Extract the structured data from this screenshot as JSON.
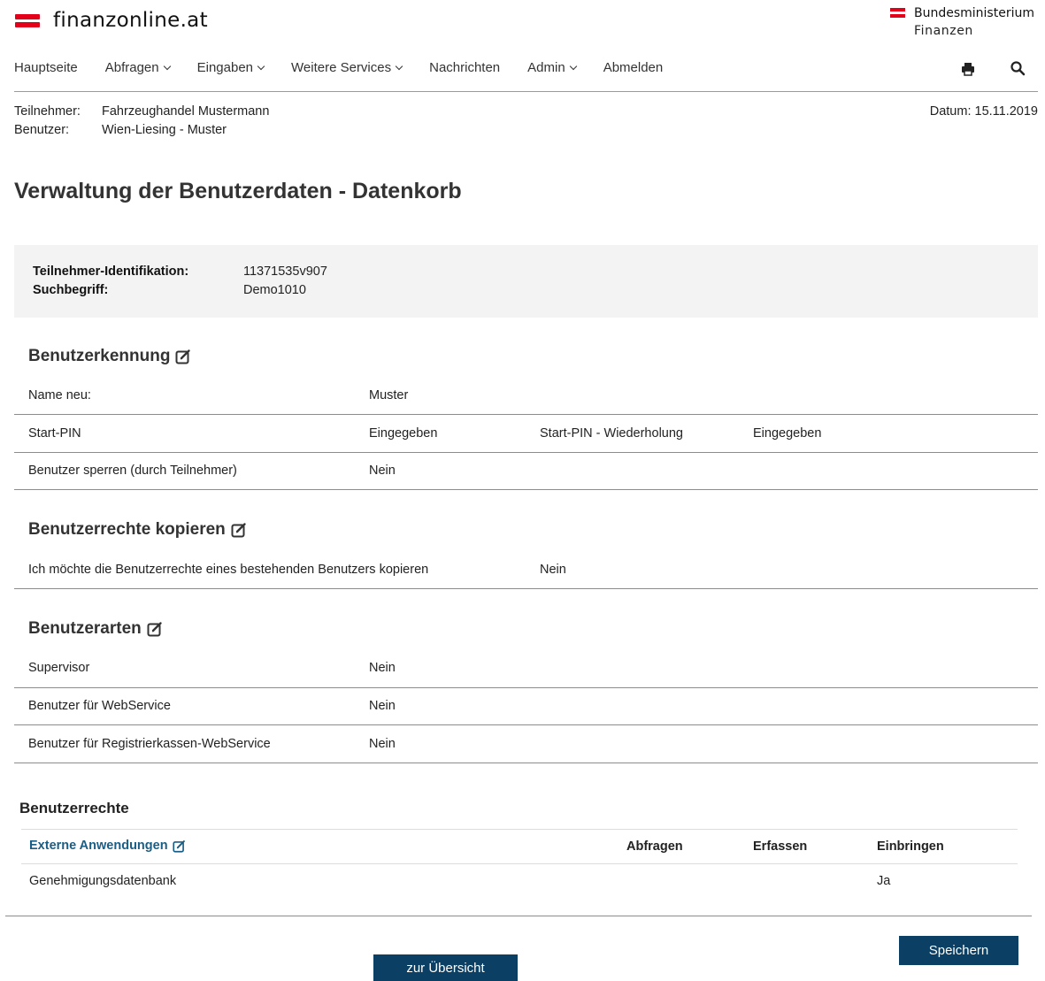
{
  "header": {
    "site_name": "finanzonline.at",
    "ministry_line1": "Bundesministerium",
    "ministry_line2": "Finanzen",
    "brand_color": "#e3001b"
  },
  "nav": {
    "items": [
      {
        "label": "Hauptseite",
        "dropdown": false
      },
      {
        "label": "Abfragen",
        "dropdown": true
      },
      {
        "label": "Eingaben",
        "dropdown": true
      },
      {
        "label": "Weitere Services",
        "dropdown": true
      },
      {
        "label": "Nachrichten",
        "dropdown": false
      },
      {
        "label": "Admin",
        "dropdown": true
      },
      {
        "label": "Abmelden",
        "dropdown": false
      }
    ],
    "icons": [
      "print-icon",
      "search-icon"
    ]
  },
  "meta": {
    "participant_label": "Teilnehmer:",
    "participant_value": "Fahrzeughandel Mustermann",
    "user_label": "Benutzer:",
    "user_value": "Wien-Liesing - Muster",
    "date": "Datum: 15.11.2019"
  },
  "page": {
    "title": "Verwaltung der Benutzerdaten - Datenkorb"
  },
  "idbox": {
    "id_label": "Teilnehmer-Identifikation:",
    "id_value": "11371535v907",
    "search_label": "Suchbegriff:",
    "search_value": "Demo1010"
  },
  "benutzerkennung": {
    "title": "Benutzerkennung",
    "name_label": "Name neu:",
    "name_value": "Muster",
    "pin_label": "Start-PIN",
    "pin_value": "Eingegeben",
    "pin_repeat_label": "Start-PIN - Wiederholung",
    "pin_repeat_value": "Eingegeben",
    "lock_label": "Benutzer sperren (durch Teilnehmer)",
    "lock_value": "Nein"
  },
  "kopieren": {
    "title": "Benutzerrechte kopieren",
    "copy_label": "Ich möchte die Benutzerrechte eines bestehenden Benutzers kopieren",
    "copy_value": "Nein"
  },
  "arten": {
    "title": "Benutzerarten",
    "rows": [
      {
        "label": "Supervisor",
        "value": "Nein"
      },
      {
        "label": "Benutzer für WebService",
        "value": "Nein"
      },
      {
        "label": "Benutzer für Registrierkassen-WebService",
        "value": "Nein"
      }
    ]
  },
  "rechte": {
    "title": "Benutzerrechte",
    "link_label": "Externe Anwendungen",
    "col_abfragen": "Abfragen",
    "col_erfassen": "Erfassen",
    "col_einbringen": "Einbringen",
    "row_name": "Genehmigungsdatenbank",
    "row_abfragen": "",
    "row_erfassen": "",
    "row_einbringen": "Ja"
  },
  "actions": {
    "save": "Speichern",
    "overview": "zur Übersicht"
  }
}
